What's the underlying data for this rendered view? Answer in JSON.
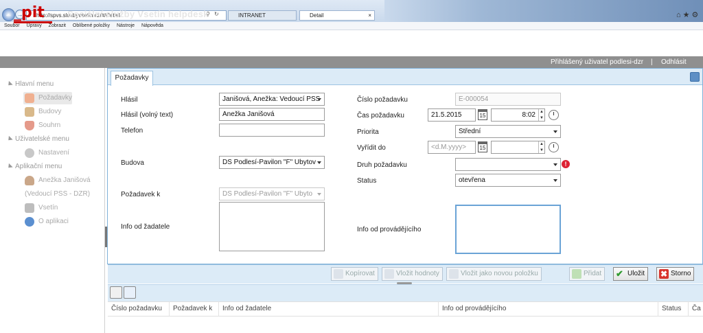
{
  "browser": {
    "address": "http://spvs.sluzbyvsetin.cz/#/Detail",
    "tabs": [
      {
        "label": "INTRANET"
      },
      {
        "label": "Detail"
      }
    ],
    "menu": [
      "Soubor",
      "Úpravy",
      "Zobrazit",
      "Oblíbené položky",
      "Nástroje",
      "Nápověda"
    ]
  },
  "app": {
    "logo": "pit",
    "title": "Sociální služby Vsetín helpdesk",
    "logged_user": "Přihlášený uživatel podlesi-dzr",
    "separator": "|",
    "logout": "Odhlásit"
  },
  "sidebar": {
    "groups": [
      {
        "label": "Hlavní menu",
        "items": [
          {
            "label": "Požadavky",
            "icon": "requests-icon"
          },
          {
            "label": "Budovy",
            "icon": "building-icon"
          },
          {
            "label": "Souhrn",
            "icon": "shield-icon"
          }
        ]
      },
      {
        "label": "Uživatelské menu",
        "items": [
          {
            "label": "Nastavení",
            "icon": "gear-icon"
          }
        ]
      },
      {
        "label": "Aplikační menu",
        "items": [
          {
            "label": "Anežka Janišová",
            "icon": "user-icon"
          },
          {
            "label": "(Vedoucí PSS - DZR)",
            "icon": ""
          },
          {
            "label": "Vsetín",
            "icon": "box-icon"
          },
          {
            "label": "O aplikaci",
            "icon": "info-icon"
          }
        ]
      }
    ]
  },
  "form": {
    "tab": "Požadavky",
    "left": {
      "hlasil_label": "Hlásil",
      "hlasil_value": "Janišová, Anežka: Vedoucí PSS",
      "hlasil_free_label": "Hlásil (volný text)",
      "hlasil_free_value": "Anežka Janišová",
      "telefon_label": "Telefon",
      "telefon_value": "",
      "budova_label": "Budova",
      "budova_value": "DS Podlesí-Pavilon \"F\" Ubytov",
      "pozadavek_k_label": "Požadavek k",
      "pozadavek_k_value": "DS Podlesí-Pavilon \"F\" Ubyto",
      "info_zadatel_label": "Info od žadatele",
      "info_zadatel_value": ""
    },
    "right": {
      "cislo_label": "Číslo požadavku",
      "cislo_value": "E-000054",
      "cas_label": "Čas požadavku",
      "cas_date": "21.5.2015",
      "cas_time": "8:02",
      "priorita_label": "Priorita",
      "priorita_value": "Střední",
      "vyridit_label": "Vyřídit do",
      "vyridit_placeholder": "<d.M.yyyy>",
      "druh_label": "Druh požadavku",
      "druh_value": "",
      "status_label": "Status",
      "status_value": "otevřena",
      "info_prov_label": "Info od provádějícího",
      "info_prov_value": "",
      "calendar_day": "15"
    }
  },
  "toolbar": {
    "kopirovat": "Kopírovat",
    "vlozit_hodnoty": "Vložit hodnoty",
    "vlozit_novou": "Vložit jako novou položku",
    "pridat": "Přidat",
    "ulozit": "Uložit",
    "storno": "Storno"
  },
  "grid": {
    "columns": [
      "Číslo požadavku",
      "Požadavek k",
      "Info od žadatele",
      "Info od provádějícího",
      "Status",
      "Ča"
    ]
  },
  "colors": {
    "brand": "#cc0000",
    "panel_header": "#dcebf7",
    "accent_border": "#7fb0d8",
    "userbar": "#8f8f8f"
  }
}
